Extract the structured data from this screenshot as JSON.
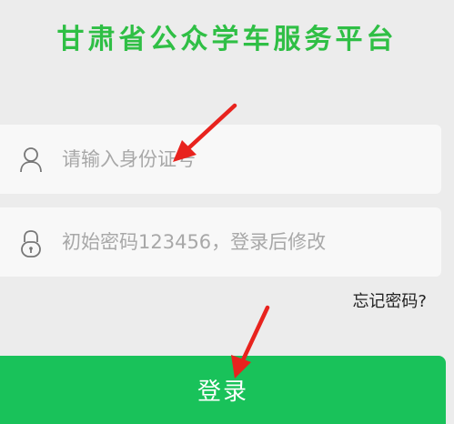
{
  "header": {
    "title": "甘肃省公众学车服务平台"
  },
  "form": {
    "id_field": {
      "placeholder": "请输入身份证号",
      "icon": "user-icon"
    },
    "password_field": {
      "placeholder": "初始密码123456，登录后修改",
      "icon": "lock-icon"
    },
    "forgot_label": "忘记密码?",
    "login_label": "登录"
  },
  "annotations": {
    "arrow_color": "#e8231e",
    "arrows": [
      "red-arrow-icon",
      "red-arrow-icon"
    ]
  },
  "colors": {
    "background": "#ececec",
    "title": "#2fbf45",
    "button": "#19c25a",
    "field_bg": "#f8f8f8",
    "placeholder": "#a8a8a8"
  }
}
